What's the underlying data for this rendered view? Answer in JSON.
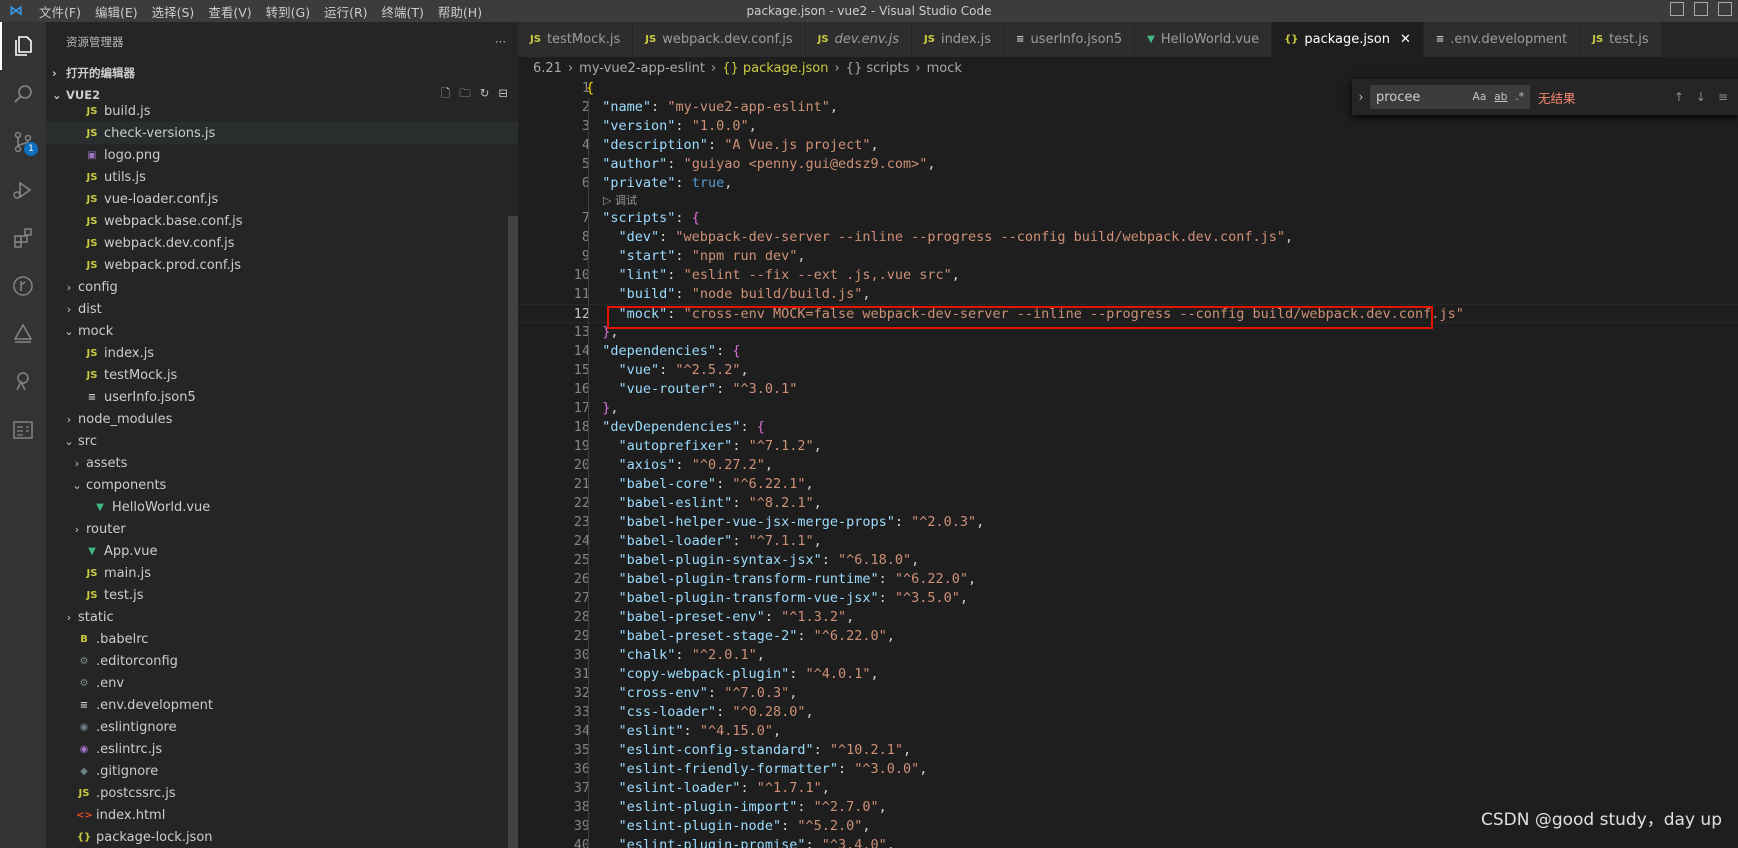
{
  "window": {
    "title": "package.json - vue2 - Visual Studio Code"
  },
  "menu": [
    "文件(F)",
    "编辑(E)",
    "选择(S)",
    "查看(V)",
    "转到(G)",
    "运行(R)",
    "终端(T)",
    "帮助(H)"
  ],
  "activity": {
    "scm_badge": "1"
  },
  "explorer": {
    "title": "资源管理器",
    "more": "···",
    "open_editors": "打开的编辑器",
    "root": "VUE2",
    "items": [
      {
        "label": "build.js",
        "icon": "JS",
        "kind": "js",
        "depth": 2
      },
      {
        "label": "check-versions.js",
        "icon": "JS",
        "kind": "js",
        "depth": 2
      },
      {
        "label": "logo.png",
        "icon": "▣",
        "kind": "img",
        "depth": 2
      },
      {
        "label": "utils.js",
        "icon": "JS",
        "kind": "js",
        "depth": 2
      },
      {
        "label": "vue-loader.conf.js",
        "icon": "JS",
        "kind": "js",
        "depth": 2
      },
      {
        "label": "webpack.base.conf.js",
        "icon": "JS",
        "kind": "js",
        "depth": 2
      },
      {
        "label": "webpack.dev.conf.js",
        "icon": "JS",
        "kind": "js",
        "depth": 2
      },
      {
        "label": "webpack.prod.conf.js",
        "icon": "JS",
        "kind": "js",
        "depth": 2
      },
      {
        "label": "config",
        "folder": "closed",
        "depth": 1
      },
      {
        "label": "dist",
        "folder": "closed",
        "depth": 1
      },
      {
        "label": "mock",
        "folder": "open",
        "depth": 1
      },
      {
        "label": "index.js",
        "icon": "JS",
        "kind": "js",
        "depth": 2
      },
      {
        "label": "testMock.js",
        "icon": "JS",
        "kind": "js",
        "depth": 2
      },
      {
        "label": "userInfo.json5",
        "icon": "≡",
        "kind": "list",
        "depth": 2
      },
      {
        "label": "node_modules",
        "folder": "closed",
        "depth": 1
      },
      {
        "label": "src",
        "folder": "open",
        "depth": 1
      },
      {
        "label": "assets",
        "folder": "closed",
        "depth": 2
      },
      {
        "label": "components",
        "folder": "open",
        "depth": 2
      },
      {
        "label": "HelloWorld.vue",
        "icon": "▼",
        "kind": "vue",
        "depth": 3
      },
      {
        "label": "router",
        "folder": "closed",
        "depth": 2
      },
      {
        "label": "App.vue",
        "icon": "▼",
        "kind": "vue",
        "depth": 2
      },
      {
        "label": "main.js",
        "icon": "JS",
        "kind": "js",
        "depth": 2
      },
      {
        "label": "test.js",
        "icon": "JS",
        "kind": "js",
        "depth": 2
      },
      {
        "label": "static",
        "folder": "closed",
        "depth": 1
      },
      {
        "label": ".babelrc",
        "icon": "B",
        "kind": "babel",
        "depth": 1
      },
      {
        "label": ".editorconfig",
        "icon": "⚙",
        "kind": "gear",
        "depth": 1
      },
      {
        "label": ".env",
        "icon": "⚙",
        "kind": "gear",
        "depth": 1
      },
      {
        "label": ".env.development",
        "icon": "≡",
        "kind": "list",
        "depth": 1
      },
      {
        "label": ".eslintignore",
        "icon": "◉",
        "kind": "git",
        "depth": 1
      },
      {
        "label": ".eslintrc.js",
        "icon": "◉",
        "kind": "eslint",
        "depth": 1
      },
      {
        "label": ".gitignore",
        "icon": "◆",
        "kind": "git",
        "depth": 1
      },
      {
        "label": ".postcssrc.js",
        "icon": "JS",
        "kind": "js",
        "depth": 1
      },
      {
        "label": "index.html",
        "icon": "<>",
        "kind": "html",
        "depth": 1
      },
      {
        "label": "package-lock.json",
        "icon": "{}",
        "kind": "json",
        "depth": 1
      }
    ]
  },
  "tabs": [
    {
      "label": "testMock.js",
      "icon": "JS",
      "kind": "js"
    },
    {
      "label": "webpack.dev.conf.js",
      "icon": "JS",
      "kind": "js"
    },
    {
      "label": "dev.env.js",
      "icon": "JS",
      "kind": "js",
      "italic": true
    },
    {
      "label": "index.js",
      "icon": "JS",
      "kind": "js"
    },
    {
      "label": "userInfo.json5",
      "icon": "≡",
      "kind": "list"
    },
    {
      "label": "HelloWorld.vue",
      "icon": "▼",
      "kind": "vue"
    },
    {
      "label": "package.json",
      "icon": "{}",
      "kind": "json",
      "active": true,
      "close": "✕"
    },
    {
      "label": ".env.development",
      "icon": "≡",
      "kind": "list"
    },
    {
      "label": "test.js",
      "icon": "JS",
      "kind": "js"
    }
  ],
  "breadcrumb": [
    "6.21",
    "my-vue2-app-eslint",
    "{} package.json",
    "{} scripts",
    "mock"
  ],
  "find": {
    "query": "procee",
    "opt_case": "Aa",
    "opt_word": "ab",
    "opt_regex": ".*",
    "status": "无结果"
  },
  "codelens": "▷ 调试",
  "code": [
    {
      "n": "1",
      "t": [
        [
          "b",
          "{"
        ]
      ]
    },
    {
      "n": "2",
      "t": [
        [
          "p",
          "  "
        ],
        [
          "k",
          "\"name\""
        ],
        [
          "p",
          ": "
        ],
        [
          "s",
          "\"my-vue2-app-eslint\""
        ],
        [
          "p",
          ","
        ]
      ]
    },
    {
      "n": "3",
      "t": [
        [
          "p",
          "  "
        ],
        [
          "k",
          "\"version\""
        ],
        [
          "p",
          ": "
        ],
        [
          "s",
          "\"1.0.0\""
        ],
        [
          "p",
          ","
        ]
      ]
    },
    {
      "n": "4",
      "t": [
        [
          "p",
          "  "
        ],
        [
          "k",
          "\"description\""
        ],
        [
          "p",
          ": "
        ],
        [
          "s",
          "\"A Vue.js project\""
        ],
        [
          "p",
          ","
        ]
      ]
    },
    {
      "n": "5",
      "t": [
        [
          "p",
          "  "
        ],
        [
          "k",
          "\"author\""
        ],
        [
          "p",
          ": "
        ],
        [
          "s",
          "\"guiyao <penny.gui@edsz9.com>\""
        ],
        [
          "p",
          ","
        ]
      ]
    },
    {
      "n": "6",
      "t": [
        [
          "p",
          "  "
        ],
        [
          "k",
          "\"private\""
        ],
        [
          "p",
          ": "
        ],
        [
          "kw",
          "true"
        ],
        [
          "p",
          ","
        ]
      ]
    },
    {
      "lens": true
    },
    {
      "n": "7",
      "t": [
        [
          "p",
          "  "
        ],
        [
          "k",
          "\"scripts\""
        ],
        [
          "p",
          ": "
        ],
        [
          "bp",
          "{"
        ]
      ]
    },
    {
      "n": "8",
      "t": [
        [
          "p",
          "    "
        ],
        [
          "k",
          "\"dev\""
        ],
        [
          "p",
          ": "
        ],
        [
          "s",
          "\"webpack-dev-server --inline --progress --config build/webpack.dev.conf.js\""
        ],
        [
          "p",
          ","
        ]
      ]
    },
    {
      "n": "9",
      "t": [
        [
          "p",
          "    "
        ],
        [
          "k",
          "\"start\""
        ],
        [
          "p",
          ": "
        ],
        [
          "s",
          "\"npm run dev\""
        ],
        [
          "p",
          ","
        ]
      ]
    },
    {
      "n": "10",
      "t": [
        [
          "p",
          "    "
        ],
        [
          "k",
          "\"lint\""
        ],
        [
          "p",
          ": "
        ],
        [
          "s",
          "\"eslint --fix --ext .js,.vue src\""
        ],
        [
          "p",
          ","
        ]
      ]
    },
    {
      "n": "11",
      "t": [
        [
          "p",
          "    "
        ],
        [
          "k",
          "\"build\""
        ],
        [
          "p",
          ": "
        ],
        [
          "s",
          "\"node build/build.js\""
        ],
        [
          "p",
          ","
        ]
      ]
    },
    {
      "n": "12",
      "cur": true,
      "t": [
        [
          "p",
          "    "
        ],
        [
          "k",
          "\"mock\""
        ],
        [
          "p",
          ": "
        ],
        [
          "s",
          "\"cross-env MOCK=false webpack-dev-server --inline --progress --config build/webpack.dev.conf.js\""
        ]
      ]
    },
    {
      "n": "13",
      "t": [
        [
          "p",
          "  "
        ],
        [
          "bp",
          "}"
        ],
        [
          "p",
          ","
        ]
      ]
    },
    {
      "n": "14",
      "t": [
        [
          "p",
          "  "
        ],
        [
          "k",
          "\"dependencies\""
        ],
        [
          "p",
          ": "
        ],
        [
          "bp",
          "{"
        ]
      ]
    },
    {
      "n": "15",
      "t": [
        [
          "p",
          "    "
        ],
        [
          "k",
          "\"vue\""
        ],
        [
          "p",
          ": "
        ],
        [
          "s",
          "\"^2.5.2\""
        ],
        [
          "p",
          ","
        ]
      ]
    },
    {
      "n": "16",
      "t": [
        [
          "p",
          "    "
        ],
        [
          "k",
          "\"vue-router\""
        ],
        [
          "p",
          ": "
        ],
        [
          "s",
          "\"^3.0.1\""
        ]
      ]
    },
    {
      "n": "17",
      "t": [
        [
          "p",
          "  "
        ],
        [
          "bp",
          "}"
        ],
        [
          "p",
          ","
        ]
      ]
    },
    {
      "n": "18",
      "t": [
        [
          "p",
          "  "
        ],
        [
          "k",
          "\"devDependencies\""
        ],
        [
          "p",
          ": "
        ],
        [
          "bp",
          "{"
        ]
      ]
    },
    {
      "n": "19",
      "t": [
        [
          "p",
          "    "
        ],
        [
          "k",
          "\"autoprefixer\""
        ],
        [
          "p",
          ": "
        ],
        [
          "s",
          "\"^7.1.2\""
        ],
        [
          "p",
          ","
        ]
      ]
    },
    {
      "n": "20",
      "t": [
        [
          "p",
          "    "
        ],
        [
          "k",
          "\"axios\""
        ],
        [
          "p",
          ": "
        ],
        [
          "s",
          "\"^0.27.2\""
        ],
        [
          "p",
          ","
        ]
      ]
    },
    {
      "n": "21",
      "t": [
        [
          "p",
          "    "
        ],
        [
          "k",
          "\"babel-core\""
        ],
        [
          "p",
          ": "
        ],
        [
          "s",
          "\"^6.22.1\""
        ],
        [
          "p",
          ","
        ]
      ]
    },
    {
      "n": "22",
      "t": [
        [
          "p",
          "    "
        ],
        [
          "k",
          "\"babel-eslint\""
        ],
        [
          "p",
          ": "
        ],
        [
          "s",
          "\"^8.2.1\""
        ],
        [
          "p",
          ","
        ]
      ]
    },
    {
      "n": "23",
      "t": [
        [
          "p",
          "    "
        ],
        [
          "k",
          "\"babel-helper-vue-jsx-merge-props\""
        ],
        [
          "p",
          ": "
        ],
        [
          "s",
          "\"^2.0.3\""
        ],
        [
          "p",
          ","
        ]
      ]
    },
    {
      "n": "24",
      "t": [
        [
          "p",
          "    "
        ],
        [
          "k",
          "\"babel-loader\""
        ],
        [
          "p",
          ": "
        ],
        [
          "s",
          "\"^7.1.1\""
        ],
        [
          "p",
          ","
        ]
      ]
    },
    {
      "n": "25",
      "t": [
        [
          "p",
          "    "
        ],
        [
          "k",
          "\"babel-plugin-syntax-jsx\""
        ],
        [
          "p",
          ": "
        ],
        [
          "s",
          "\"^6.18.0\""
        ],
        [
          "p",
          ","
        ]
      ]
    },
    {
      "n": "26",
      "t": [
        [
          "p",
          "    "
        ],
        [
          "k",
          "\"babel-plugin-transform-runtime\""
        ],
        [
          "p",
          ": "
        ],
        [
          "s",
          "\"^6.22.0\""
        ],
        [
          "p",
          ","
        ]
      ]
    },
    {
      "n": "27",
      "t": [
        [
          "p",
          "    "
        ],
        [
          "k",
          "\"babel-plugin-transform-vue-jsx\""
        ],
        [
          "p",
          ": "
        ],
        [
          "s",
          "\"^3.5.0\""
        ],
        [
          "p",
          ","
        ]
      ]
    },
    {
      "n": "28",
      "t": [
        [
          "p",
          "    "
        ],
        [
          "k",
          "\"babel-preset-env\""
        ],
        [
          "p",
          ": "
        ],
        [
          "s",
          "\"^1.3.2\""
        ],
        [
          "p",
          ","
        ]
      ]
    },
    {
      "n": "29",
      "t": [
        [
          "p",
          "    "
        ],
        [
          "k",
          "\"babel-preset-stage-2\""
        ],
        [
          "p",
          ": "
        ],
        [
          "s",
          "\"^6.22.0\""
        ],
        [
          "p",
          ","
        ]
      ]
    },
    {
      "n": "30",
      "t": [
        [
          "p",
          "    "
        ],
        [
          "k",
          "\"chalk\""
        ],
        [
          "p",
          ": "
        ],
        [
          "s",
          "\"^2.0.1\""
        ],
        [
          "p",
          ","
        ]
      ]
    },
    {
      "n": "31",
      "t": [
        [
          "p",
          "    "
        ],
        [
          "k",
          "\"copy-webpack-plugin\""
        ],
        [
          "p",
          ": "
        ],
        [
          "s",
          "\"^4.0.1\""
        ],
        [
          "p",
          ","
        ]
      ]
    },
    {
      "n": "32",
      "t": [
        [
          "p",
          "    "
        ],
        [
          "k",
          "\"cross-env\""
        ],
        [
          "p",
          ": "
        ],
        [
          "s",
          "\"^7.0.3\""
        ],
        [
          "p",
          ","
        ]
      ]
    },
    {
      "n": "33",
      "t": [
        [
          "p",
          "    "
        ],
        [
          "k",
          "\"css-loader\""
        ],
        [
          "p",
          ": "
        ],
        [
          "s",
          "\"^0.28.0\""
        ],
        [
          "p",
          ","
        ]
      ]
    },
    {
      "n": "34",
      "t": [
        [
          "p",
          "    "
        ],
        [
          "k",
          "\"eslint\""
        ],
        [
          "p",
          ": "
        ],
        [
          "s",
          "\"^4.15.0\""
        ],
        [
          "p",
          ","
        ]
      ]
    },
    {
      "n": "35",
      "t": [
        [
          "p",
          "    "
        ],
        [
          "k",
          "\"eslint-config-standard\""
        ],
        [
          "p",
          ": "
        ],
        [
          "s",
          "\"^10.2.1\""
        ],
        [
          "p",
          ","
        ]
      ]
    },
    {
      "n": "36",
      "t": [
        [
          "p",
          "    "
        ],
        [
          "k",
          "\"eslint-friendly-formatter\""
        ],
        [
          "p",
          ": "
        ],
        [
          "s",
          "\"^3.0.0\""
        ],
        [
          "p",
          ","
        ]
      ]
    },
    {
      "n": "37",
      "t": [
        [
          "p",
          "    "
        ],
        [
          "k",
          "\"eslint-loader\""
        ],
        [
          "p",
          ": "
        ],
        [
          "s",
          "\"^1.7.1\""
        ],
        [
          "p",
          ","
        ]
      ]
    },
    {
      "n": "38",
      "t": [
        [
          "p",
          "    "
        ],
        [
          "k",
          "\"eslint-plugin-import\""
        ],
        [
          "p",
          ": "
        ],
        [
          "s",
          "\"^2.7.0\""
        ],
        [
          "p",
          ","
        ]
      ]
    },
    {
      "n": "39",
      "t": [
        [
          "p",
          "    "
        ],
        [
          "k",
          "\"eslint-plugin-node\""
        ],
        [
          "p",
          ": "
        ],
        [
          "s",
          "\"^5.2.0\""
        ],
        [
          "p",
          ","
        ]
      ]
    },
    {
      "n": "40",
      "t": [
        [
          "p",
          "    "
        ],
        [
          "k",
          "\"eslint-plugin-promise\""
        ],
        [
          "p",
          ": "
        ],
        [
          "s",
          "\"^3.4.0\""
        ],
        [
          "p",
          ","
        ]
      ]
    }
  ],
  "watermark": "CSDN @good study，day up",
  "colors": {
    "accent": "#0e70c0",
    "highlight_border": "#e51400",
    "no_result": "#f48771"
  }
}
